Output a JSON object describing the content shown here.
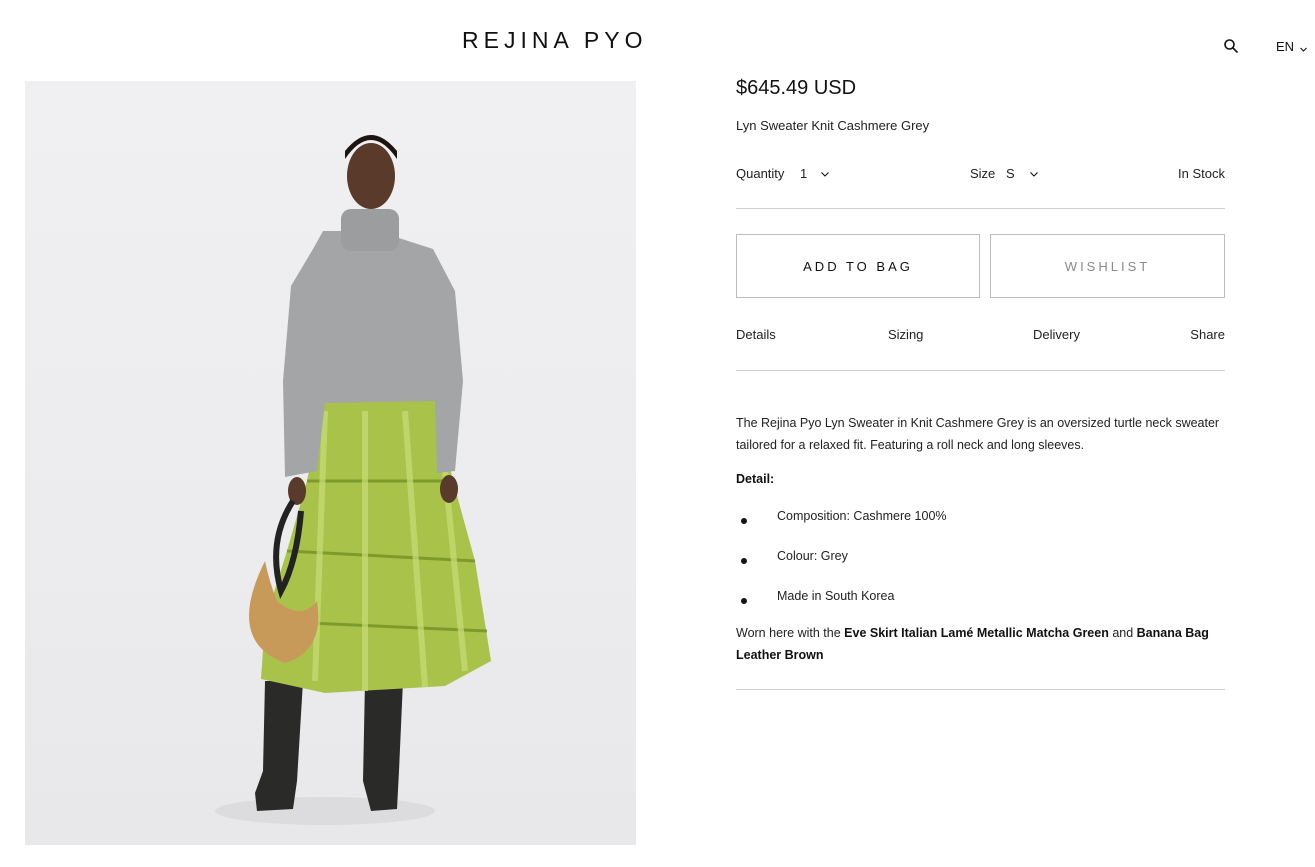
{
  "header": {
    "logo": "REJINA PYO",
    "language": "EN"
  },
  "product": {
    "price": "$645.49 USD",
    "name": "Lyn Sweater Knit Cashmere Grey",
    "quantity_label": "Quantity",
    "quantity_value": "1",
    "size_label": "Size",
    "size_value": "S",
    "stock_status": "In Stock",
    "add_to_bag_label": "ADD TO BAG",
    "wishlist_label": "WISHLIST"
  },
  "tabs": [
    "Details",
    "Sizing",
    "Delivery",
    "Share"
  ],
  "details": {
    "description": "The Rejina Pyo Lyn Sweater in Knit Cashmere Grey is an oversized turtle neck sweater tailored for a relaxed fit. Featuring a roll neck and long sleeves.",
    "detail_heading": "Detail:",
    "bullets": [
      "Composition: Cashmere 100%",
      "Colour: Grey",
      "Made in South Korea"
    ],
    "worn_prefix": "Worn here with the ",
    "worn_link_1": "Eve Skirt Italian Lamé Metallic Matcha Green",
    "worn_and": " and ",
    "worn_link_2": "Banana Bag Leather Brown"
  },
  "icons": {
    "search": "search-icon",
    "language_chevron": "chevron-down-icon",
    "quantity_chevron": "chevron-down-icon",
    "size_chevron": "chevron-down-icon"
  },
  "colors": {
    "text": "#111111",
    "rule": "#cfcfcf",
    "button_border": "#bdbdbd",
    "wishlist_text": "#8a8a8a"
  }
}
